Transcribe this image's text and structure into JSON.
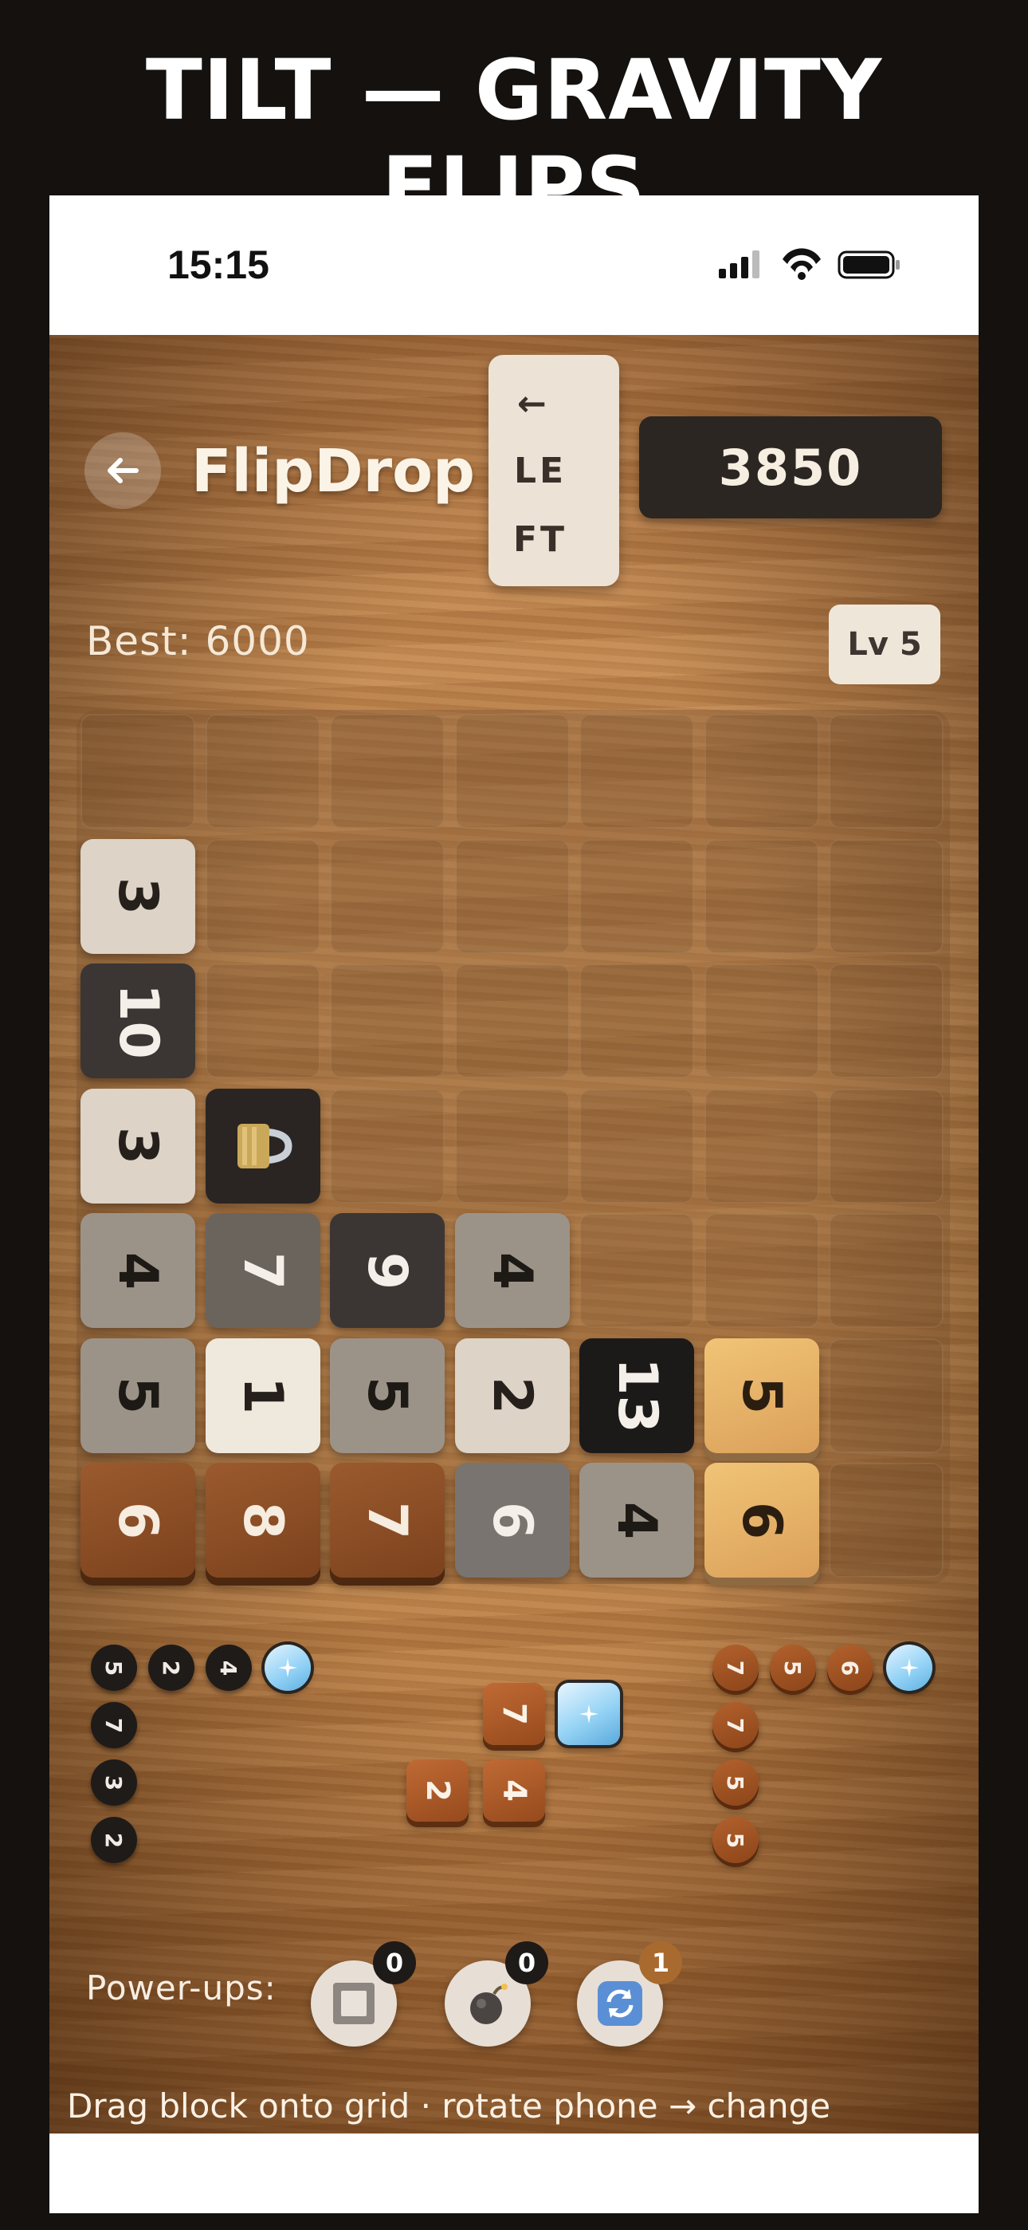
{
  "headline": "TILT — GRAVITY FLIPS",
  "status_bar": {
    "time": "15:15"
  },
  "header": {
    "back_icon": "arrow-left-icon",
    "title": "FlipDrop",
    "direction": {
      "arrow": "←",
      "line1": "LE",
      "line2": "FT"
    },
    "score": "3850"
  },
  "stats": {
    "best": "Best: 6000",
    "level": "Lv 5"
  },
  "board": {
    "tiles": [
      {
        "row": 1,
        "col": 0,
        "value": "3",
        "style": "light"
      },
      {
        "row": 2,
        "col": 0,
        "value": "10",
        "style": "dark"
      },
      {
        "row": 3,
        "col": 0,
        "value": "3",
        "style": "light"
      },
      {
        "row": 3,
        "col": 1,
        "value": "",
        "style": "lock",
        "icon": "padlock-icon"
      },
      {
        "row": 4,
        "col": 0,
        "value": "4",
        "style": "gray"
      },
      {
        "row": 4,
        "col": 1,
        "value": "7",
        "style": "mid"
      },
      {
        "row": 4,
        "col": 2,
        "value": "9",
        "style": "dark"
      },
      {
        "row": 4,
        "col": 3,
        "value": "4",
        "style": "gray"
      },
      {
        "row": 5,
        "col": 0,
        "value": "5",
        "style": "gray"
      },
      {
        "row": 5,
        "col": 1,
        "value": "1",
        "style": "cream"
      },
      {
        "row": 5,
        "col": 2,
        "value": "5",
        "style": "gray"
      },
      {
        "row": 5,
        "col": 3,
        "value": "2",
        "style": "light"
      },
      {
        "row": 5,
        "col": 4,
        "value": "13",
        "style": "black"
      },
      {
        "row": 5,
        "col": 5,
        "value": "5",
        "style": "gold"
      },
      {
        "row": 6,
        "col": 0,
        "value": "6",
        "style": "wood"
      },
      {
        "row": 6,
        "col": 1,
        "value": "8",
        "style": "wood"
      },
      {
        "row": 6,
        "col": 2,
        "value": "7",
        "style": "wood"
      },
      {
        "row": 6,
        "col": 3,
        "value": "6",
        "style": "slate"
      },
      {
        "row": 6,
        "col": 4,
        "value": "4",
        "style": "gray"
      },
      {
        "row": 6,
        "col": 5,
        "value": "6",
        "style": "gold"
      }
    ]
  },
  "tray": {
    "left_piece": [
      {
        "value": "5",
        "style": "dark"
      },
      {
        "value": "2",
        "style": "dark"
      },
      {
        "value": "4",
        "style": "dark"
      },
      {
        "value": "",
        "style": "ice"
      },
      {
        "value": "7",
        "style": "dark"
      },
      {
        "value": "3",
        "style": "dark"
      },
      {
        "value": "2",
        "style": "dark"
      }
    ],
    "center_piece": [
      {
        "value": "7",
        "style": "wood"
      },
      {
        "value": "",
        "style": "ice"
      },
      {
        "value": "2",
        "style": "wood"
      },
      {
        "value": "4",
        "style": "wood"
      }
    ],
    "right_piece": [
      {
        "value": "7",
        "style": "wood"
      },
      {
        "value": "5",
        "style": "wood"
      },
      {
        "value": "6",
        "style": "wood"
      },
      {
        "value": "",
        "style": "ice"
      },
      {
        "value": "7",
        "style": "wood"
      },
      {
        "value": "5",
        "style": "wood"
      },
      {
        "value": "5",
        "style": "wood"
      }
    ]
  },
  "powerups": {
    "label": "Power-ups:",
    "items": [
      {
        "name": "block",
        "icon": "square-block-icon",
        "count": "0",
        "badge_color": "#1e1a18"
      },
      {
        "name": "bomb",
        "icon": "bomb-icon",
        "count": "0",
        "badge_color": "#1e1a18"
      },
      {
        "name": "shuffle",
        "icon": "refresh-icon",
        "count": "1",
        "badge_color": "#a86a2e"
      }
    ]
  },
  "hint": "Drag block onto grid · rotate phone → change"
}
